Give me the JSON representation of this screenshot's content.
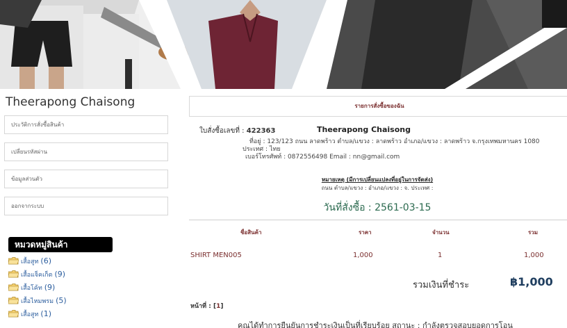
{
  "sidebar": {
    "user_name": "Theerapong Chaisong",
    "menu": [
      "ประวัติการสั่งซื้อสินค้า",
      "เปลี่ยนรหัสผ่าน",
      "ข้อมูลส่วนตัว",
      "ออกจากระบบ"
    ],
    "category_heading": "หมวดหมู่สินค้า",
    "categories": [
      {
        "name": "เสื้อสูท",
        "count": "(6)"
      },
      {
        "name": "เสื้อแจ็คเก็ต",
        "count": "(9)"
      },
      {
        "name": "เสื้อโค้ท",
        "count": "(9)"
      },
      {
        "name": "เสื้อไหมพรม",
        "count": "(5)"
      },
      {
        "name": "เสื้อสูท",
        "count": "(1)"
      }
    ]
  },
  "order": {
    "panel_title": "รายการสั่งซื้อของฉัน",
    "order_no_label": "ใบสั่งซื้อเลขที่ :",
    "order_no": "422363",
    "customer_name": "Theerapong Chaisong",
    "address_line1": "ที่อยู่ : 123/123 ถนน ลาดพร้าว ตำบล/แขวง : ลาดพร้าว อำเภอ/แขวง : ลาดพร้าว จ.กรุงเทพมหานคร 1080",
    "address_line2": "ประเทศ : ไทย",
    "contact_line": "เบอร์โทรศัพท์ : 0872556498 Email : nn@gmail.com",
    "note_title": "หมายเหตุ (มีการเปลี่ยนแปลงที่อยู่ในการจัดส่ง)",
    "note_text": "ถนน ตำบล/แขวง : อำเภอ/แขวง : จ. ประเทศ :",
    "order_date": "วันที่สั่งซื้อ : 2561-03-15",
    "columns": [
      "ชื่อสินค้า",
      "ราคา",
      "จำนวน",
      "รวม"
    ],
    "items": [
      {
        "name": "SHIRT MEN005",
        "price": "1,000",
        "qty": "1",
        "total": "1,000"
      }
    ],
    "total_label": "รวมเงินที่ชำระ",
    "total_value": "฿1,000",
    "page_label": "หน้าที่ :",
    "page_current": "1",
    "payment_message": "คุณได้ทำการยืนยันการชำระเงินเป็นที่เรียบร้อย สถานะ : กำลังตรวจสอบยอดการโอน"
  },
  "colors": {
    "accent": "#7a2e2e",
    "link": "#2c5e9e",
    "date": "#2b6a4f",
    "total": "#1f3e5f"
  },
  "icons": [
    "folder-icon"
  ]
}
